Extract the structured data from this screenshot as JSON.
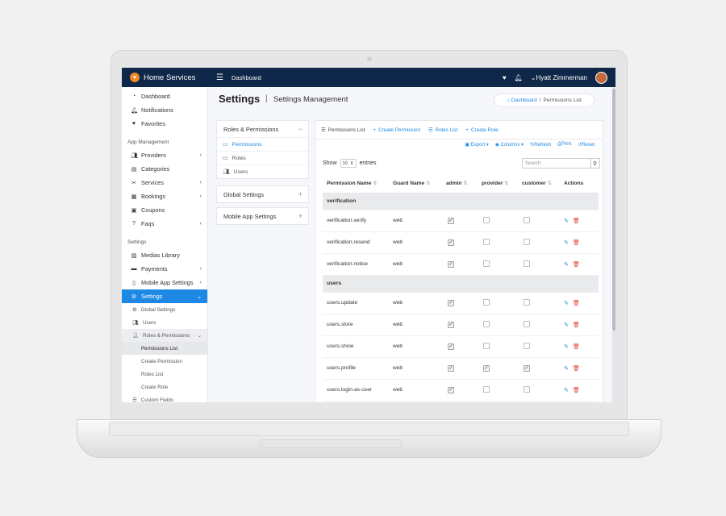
{
  "app": {
    "brand": "Home Services",
    "top_link": "Dashboard",
    "user_name": "Hyatt Zimmerman"
  },
  "sidebar": {
    "items_top": [
      {
        "label": "Dashboard",
        "icon": "gauge-icon"
      },
      {
        "label": "Notifications",
        "icon": "bell-icon"
      },
      {
        "label": "Favorites",
        "icon": "heart-icon"
      }
    ],
    "section_app": "App Management",
    "items_app": [
      {
        "label": "Providers",
        "icon": "users-icon",
        "caret": "‹"
      },
      {
        "label": "Categories",
        "icon": "folder-icon",
        "caret": ""
      },
      {
        "label": "Services",
        "icon": "tools-icon",
        "caret": "‹"
      },
      {
        "label": "Bookings",
        "icon": "calendar-icon",
        "caret": "‹"
      },
      {
        "label": "Coupons",
        "icon": "ticket-icon",
        "caret": ""
      },
      {
        "label": "Faqs",
        "icon": "question-icon",
        "caret": "‹"
      }
    ],
    "section_settings": "Settings",
    "items_settings": [
      {
        "label": "Medias Library",
        "icon": "images-icon",
        "caret": ""
      },
      {
        "label": "Payments",
        "icon": "card-icon",
        "caret": "‹"
      },
      {
        "label": "Mobile App Settings",
        "icon": "mobile-icon",
        "caret": "‹"
      }
    ],
    "active_item": "Settings",
    "sub_items": [
      "Global Settings",
      "Users",
      "Roles & Permissions"
    ],
    "sub_sub_items": [
      "Permissions List",
      "Create Permission",
      "Roles List",
      "Create Role"
    ],
    "last_item": "Custom Fields"
  },
  "page": {
    "title": "Settings",
    "separator": "|",
    "subtitle": "Settings Management",
    "breadcrumb_home": "Dashboard",
    "breadcrumb_sep": "/",
    "breadcrumb_current": "Permissions List"
  },
  "left_panel": {
    "roles_header": "Roles & Permissions",
    "roles_toggle": "−",
    "roles_items": [
      "Permissions",
      "Roles",
      "Users"
    ],
    "global_header": "Global Settings",
    "mobile_header": "Mobile App Settings",
    "plus": "+"
  },
  "tabs": [
    "Permissions List",
    "Create Permission",
    "Roles List",
    "Create Role"
  ],
  "tools": [
    "Export",
    "Columns",
    "Refresh",
    "Print",
    "Reset"
  ],
  "table_controls": {
    "show_label": "Show",
    "entries_value": "10",
    "entries_label": "entries",
    "search_placeholder": "Search"
  },
  "columns": [
    "Permission Name",
    "Guard Name",
    "admin",
    "provider",
    "customer",
    "Actions"
  ],
  "groups": [
    {
      "name": "verification",
      "rows": [
        {
          "name": "verification.verify",
          "guard": "web",
          "admin": true,
          "provider": false,
          "customer": false
        },
        {
          "name": "verification.resend",
          "guard": "web",
          "admin": true,
          "provider": false,
          "customer": false
        },
        {
          "name": "verification.notice",
          "guard": "web",
          "admin": true,
          "provider": false,
          "customer": false
        }
      ]
    },
    {
      "name": "users",
      "rows": [
        {
          "name": "users.update",
          "guard": "web",
          "admin": true,
          "provider": false,
          "customer": false
        },
        {
          "name": "users.store",
          "guard": "web",
          "admin": true,
          "provider": false,
          "customer": false
        },
        {
          "name": "users.show",
          "guard": "web",
          "admin": true,
          "provider": false,
          "customer": false
        },
        {
          "name": "users.profile",
          "guard": "web",
          "admin": true,
          "provider": true,
          "customer": true
        },
        {
          "name": "users.login-as-user",
          "guard": "web",
          "admin": true,
          "provider": false,
          "customer": false
        }
      ]
    }
  ],
  "colors": {
    "topbar": "#0f2748",
    "accent": "#1e88e5",
    "delete": "#e53935",
    "logo": "#f08a24"
  }
}
